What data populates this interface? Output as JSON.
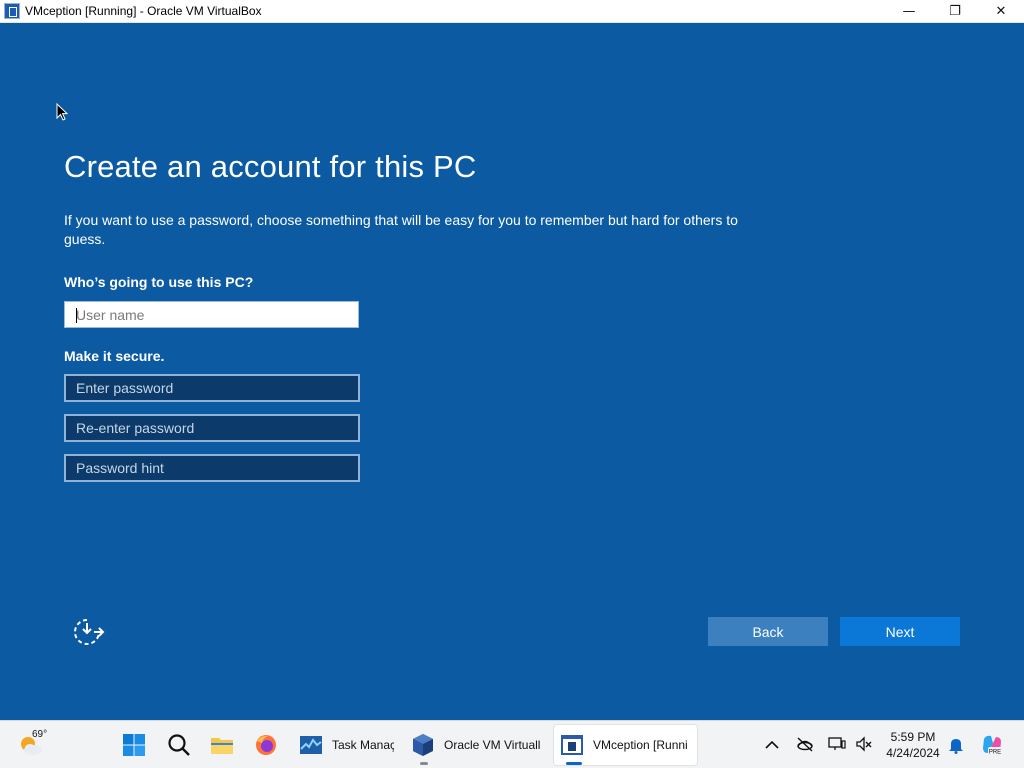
{
  "window": {
    "title": "VMception [Running] - Oracle VM VirtualBox",
    "minimize_glyph": "—",
    "restore_glyph": "❐",
    "close_glyph": "✕"
  },
  "oobe": {
    "title": "Create an account for this PC",
    "description": "If you want to use a password, choose something that will be easy for you to remember but hard for others to guess.",
    "who_label": "Who’s going to use this PC?",
    "username_placeholder": "User name",
    "username_value": "",
    "secure_label": "Make it secure.",
    "password_placeholder": "Enter password",
    "reenter_placeholder": "Re-enter password",
    "hint_placeholder": "Password hint",
    "back_label": "Back",
    "next_label": "Next",
    "accessibility_icon": "accessibility-icon"
  },
  "taskbar": {
    "weather_temp": "69°",
    "apps": [
      {
        "name": "start",
        "icon": "windows-logo-icon"
      },
      {
        "name": "search",
        "icon": "search-icon"
      },
      {
        "name": "file-explorer",
        "icon": "folder-icon"
      },
      {
        "name": "firefox",
        "icon": "firefox-icon"
      },
      {
        "name": "task-manager",
        "icon": "task-manager-icon",
        "label": "Task Manaç"
      },
      {
        "name": "virtualbox",
        "icon": "virtualbox-icon",
        "label": "Oracle VM Virtuall"
      },
      {
        "name": "vmception",
        "icon": "vm-window-icon",
        "label": "VMception [Runni"
      }
    ],
    "time": "5:59 PM",
    "date": "4/24/2024"
  },
  "colors": {
    "oobe_background": "#0b5aa2",
    "field_background": "#0b3a6b",
    "back_button": "#3d80c0",
    "next_button": "#0b78d7",
    "taskbar": "#f2f3f5"
  }
}
